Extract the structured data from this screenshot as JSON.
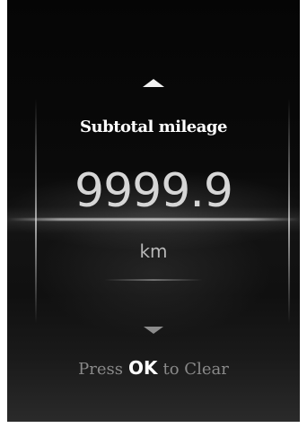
{
  "display": {
    "title": "Subtotal mileage",
    "value": "9999.9",
    "unit": "km",
    "hint_prefix": "Press",
    "hint_key": "OK",
    "hint_suffix": "to Clear",
    "up_icon": "chevron-up-icon",
    "down_icon": "chevron-down-icon"
  }
}
